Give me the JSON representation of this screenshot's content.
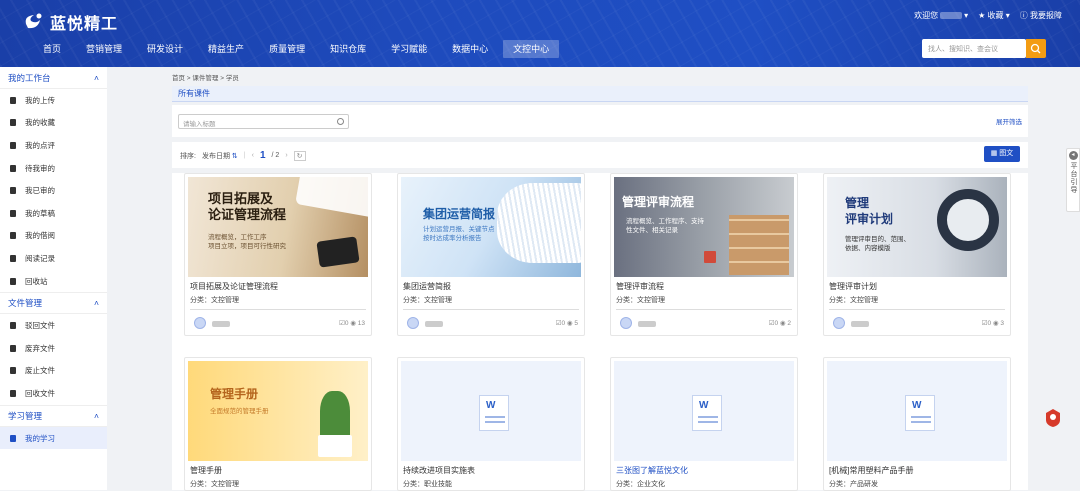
{
  "brand": {
    "name": "蓝悦精工",
    "primary": "#1f4fc4",
    "accent": "#f39c12"
  },
  "top_right": {
    "welcome": "欢迎您",
    "favorites": "收藏",
    "feedback": "我要报障"
  },
  "nav": [
    "首页",
    "营销管理",
    "研发设计",
    "精益生产",
    "质量管理",
    "知识仓库",
    "学习赋能",
    "数据中心",
    "文控中心"
  ],
  "nav_active": "文控中心",
  "search": {
    "placeholder": "找人、搜知识、查会议"
  },
  "sidebar": {
    "groups": [
      {
        "title": "我的工作台",
        "items": [
          "我的上传",
          "我的收藏",
          "我的点评",
          "待我审的",
          "我已审的",
          "我的草稿",
          "我的借阅",
          "阅读记录",
          "回收站"
        ]
      },
      {
        "title": "文件管理",
        "items": [
          "驳回文件",
          "废弃文件",
          "废止文件",
          "回收文件"
        ]
      },
      {
        "title": "学习管理",
        "items": [
          "我的学习"
        ]
      }
    ]
  },
  "breadcrumb": [
    "首页",
    "课件管理",
    "学员"
  ],
  "section_title": "所有课件",
  "filter": {
    "placeholder": "请输入标题",
    "expand": "展开筛选"
  },
  "sort": {
    "label": "排序:",
    "value": "发布日期",
    "page": "1",
    "total": "/ 2"
  },
  "view_toggle": "图文",
  "cards": [
    {
      "title": "项目拓展及论证管理流程",
      "cat": "分类：文控管理",
      "likes": "0",
      "views": "13",
      "img_title": "项目拓展及\n论证管理流程",
      "img_sub": "流程概览，工作工序\n项目立项，项目可行性研究"
    },
    {
      "title": "集团运营简报",
      "cat": "分类：文控管理",
      "likes": "0",
      "views": "5",
      "img_title": "集团运营简报",
      "img_sub": "计划运营月报、关键节点\n按时达成率分析报告"
    },
    {
      "title": "管理评审流程",
      "cat": "分类：文控管理",
      "likes": "0",
      "views": "2",
      "img_title": "管理评审流程",
      "img_sub": "流程概览、工作程序、支持\n性文件、相关记录"
    },
    {
      "title": "管理评审计划",
      "cat": "分类：文控管理",
      "likes": "0",
      "views": "3",
      "img_title": "管理\n评审计划",
      "img_sub": "管理评审目的、范围、\n依据、内容模版"
    },
    {
      "title": "管理手册",
      "cat": "分类：文控管理",
      "img_title": "管理手册",
      "img_sub": "全面规范的管理手册"
    },
    {
      "title": "持续改进项目实施表",
      "cat": "分类：职业技能"
    },
    {
      "title": "三张图了解蓝悦文化",
      "cat": "分类：企业文化"
    },
    {
      "title": "[机械]常用塑料产品手册",
      "cat": "分类：产品研发"
    }
  ],
  "right_tab": "平台引导"
}
